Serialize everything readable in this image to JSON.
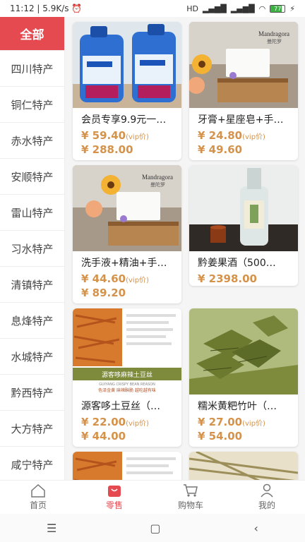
{
  "status": {
    "time": "11:12",
    "speed": "5.9K/s",
    "network": "HD",
    "battery": "77"
  },
  "sidebar": {
    "items": [
      {
        "label": "全部",
        "active": true
      },
      {
        "label": "四川特产"
      },
      {
        "label": "铜仁特产"
      },
      {
        "label": "赤水特产"
      },
      {
        "label": "安顺特产"
      },
      {
        "label": "雷山特产"
      },
      {
        "label": "习水特产"
      },
      {
        "label": "清镇特产"
      },
      {
        "label": "息烽特产"
      },
      {
        "label": "水城特产"
      },
      {
        "label": "黔西特产"
      },
      {
        "label": "大方特产"
      },
      {
        "label": "咸宁特产"
      }
    ]
  },
  "products": [
    {
      "name": "会员专享9.9元一…",
      "vip_price": "¥ 59.40",
      "vip_tag": "(vip价)",
      "price": "¥ 288.00",
      "image": "laundry-detergent"
    },
    {
      "name": "牙膏+星座皂+手…",
      "vip_price": "¥ 24.80",
      "vip_tag": "(vip价)",
      "price": "¥ 49.60",
      "image": "soap-gift"
    },
    {
      "name": "洗手液+精油+手…",
      "vip_price": "¥ 44.60",
      "vip_tag": "(vip价)",
      "price": "¥ 89.20",
      "image": "soap-gift"
    },
    {
      "name": "黔姜果酒（500…",
      "vip_price": "",
      "vip_tag": "",
      "price": "¥ 2398.00",
      "image": "fruit-wine"
    },
    {
      "name": "源客哆土豆丝（…",
      "vip_price": "¥ 22.00",
      "vip_tag": "(vip价)",
      "price": "¥ 44.00",
      "image": "potato-strips"
    },
    {
      "name": "糯米黄粑竹叶（…",
      "vip_price": "¥ 27.00",
      "vip_tag": "(vip价)",
      "price": "¥ 54.00",
      "image": "rice-cake"
    }
  ],
  "product_images": {
    "potato_caption": "源客哆麻辣土豆丝",
    "potato_sub": "GUIYANG CRISPY BEAN REASON",
    "potato_desc": "色泽金黄  麻辣酥脆  越吃越有味",
    "brand": "Mandragora",
    "brand_cn": "曼陀罗"
  },
  "tabbar": {
    "items": [
      {
        "label": "首页",
        "icon": "home-icon"
      },
      {
        "label": "零售",
        "icon": "shop-bag-icon",
        "active": true
      },
      {
        "label": "购物车",
        "icon": "cart-icon"
      },
      {
        "label": "我的",
        "icon": "user-icon"
      }
    ]
  },
  "colors": {
    "accent": "#e64a51",
    "price": "#d5924a"
  }
}
